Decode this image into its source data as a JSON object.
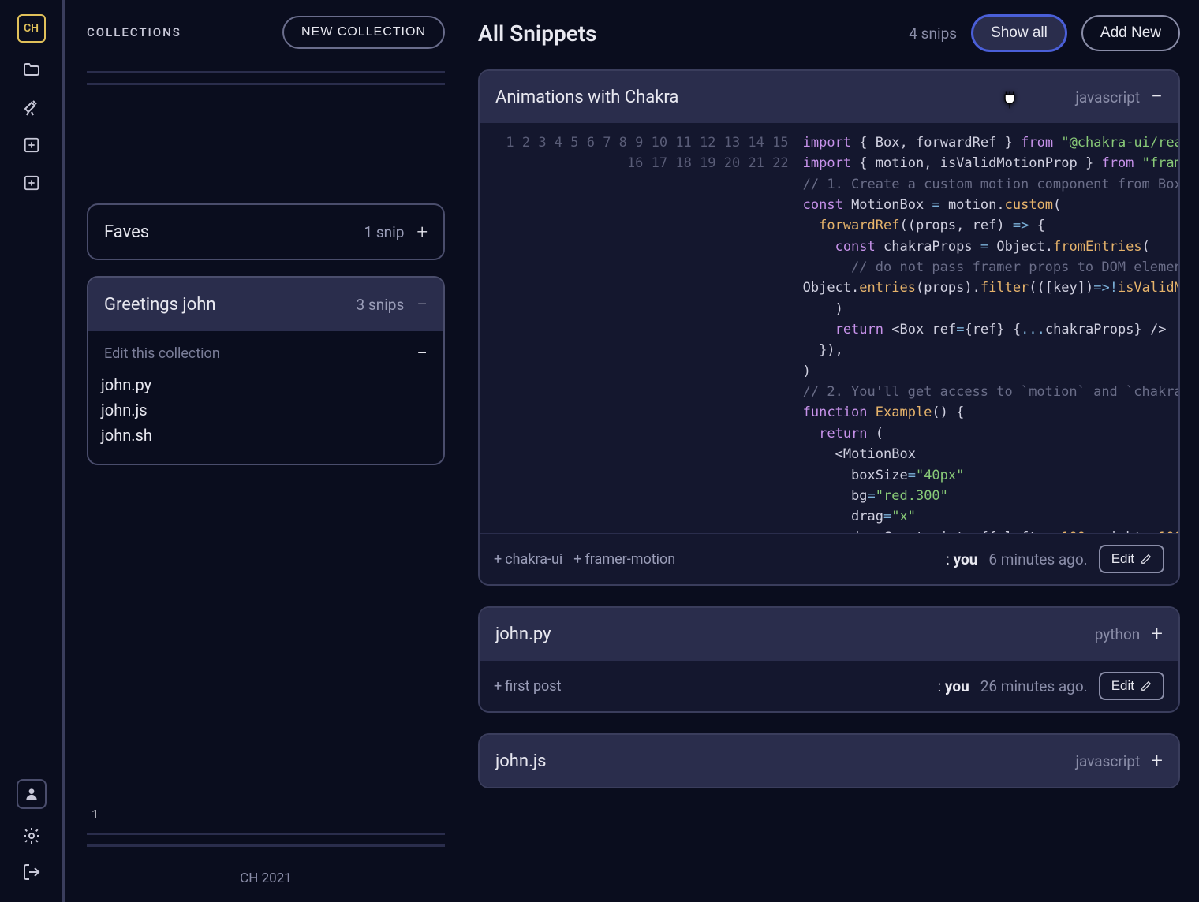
{
  "rail": {
    "logo": "CH"
  },
  "sidebar": {
    "title": "COLLECTIONS",
    "new_button": "NEW COLLECTION",
    "pager": "1",
    "footer": "CH 2021",
    "collections": [
      {
        "name": "Faves",
        "count": "1 snip",
        "expanded": false
      },
      {
        "name": "Greetings john",
        "count": "3 snips",
        "expanded": true,
        "edit_label": "Edit this collection",
        "files": [
          "john.py",
          "john.js",
          "john.sh"
        ]
      }
    ]
  },
  "main": {
    "title": "All Snippets",
    "count": "4 snips",
    "show_all": "Show all",
    "add_new": "Add New"
  },
  "snippets": [
    {
      "title": "Animations with Chakra",
      "lang": "javascript",
      "expanded": true,
      "tags": [
        "chakra-ui",
        "framer-motion"
      ],
      "author_prefix": ": ",
      "author": "you",
      "time": "6 minutes ago.",
      "edit": "Edit"
    },
    {
      "title": "john.py",
      "lang": "python",
      "expanded": false,
      "tags": [
        "first post"
      ],
      "author_prefix": ": ",
      "author": "you",
      "time": "26 minutes ago.",
      "edit": "Edit"
    },
    {
      "title": "john.js",
      "lang": "javascript",
      "expanded": false
    }
  ],
  "code": {
    "lines": 22
  }
}
